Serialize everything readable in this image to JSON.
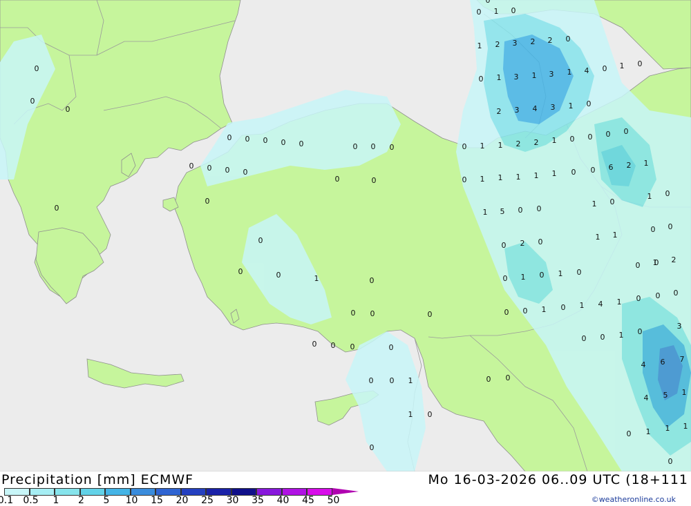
{
  "map": {
    "colors": {
      "sea": "#ececec",
      "land": "#c6f59c",
      "border": "#9a9a9a"
    },
    "precip_values": [
      [
        "0",
        "1",
        "0"
      ],
      [
        "1",
        "2",
        "3",
        "2",
        "2",
        "0"
      ],
      [
        "0",
        "1",
        "3",
        "1",
        "3",
        "1",
        "4",
        "0",
        "1",
        "0"
      ],
      [
        "2",
        "3",
        "4",
        "3",
        "1",
        "0"
      ],
      [
        "0",
        "1",
        "1",
        "2",
        "2",
        "1",
        "0",
        "0",
        "0",
        "0"
      ],
      [
        "0",
        "1",
        "1",
        "1",
        "1",
        "1",
        "0",
        "0",
        "6",
        "2",
        "1"
      ],
      [
        "1",
        "5",
        "0",
        "0",
        "1",
        "0",
        "1",
        "0"
      ],
      [
        "0",
        "2",
        "0",
        "1",
        "1",
        "0",
        "0",
        "1",
        "2"
      ],
      [
        "0",
        "1",
        "0",
        "1",
        "0",
        "0",
        "0",
        "0"
      ],
      [
        "0",
        "0",
        "1",
        "0",
        "1",
        "4",
        "1",
        "0",
        "0",
        "3"
      ],
      [
        "0",
        "0",
        "1",
        "0",
        "4",
        "6",
        "7"
      ],
      [
        "4",
        "5",
        "1",
        "0",
        "1",
        "1",
        "1",
        "0"
      ],
      [
        "0",
        "0",
        "0",
        "0",
        "0",
        "0",
        "0",
        "0",
        "0",
        "0",
        "0",
        "0",
        "0",
        "0",
        "0",
        "0",
        "0",
        "0",
        "0",
        "0",
        "0",
        "0",
        "0",
        "0",
        "0",
        "0",
        "0",
        "0",
        "0",
        "0",
        "0",
        "0",
        "0"
      ],
      [
        "1",
        "0",
        "1",
        "1",
        "0",
        "0",
        "0",
        "1",
        "0",
        "0",
        "1",
        "0",
        "0",
        "0",
        "0",
        "0",
        "0",
        "1",
        "1",
        "2",
        "1",
        "0",
        "1",
        "0",
        "0"
      ]
    ]
  },
  "legend": {
    "title": "Precipitation [mm] ECMWF",
    "datetime": "Mo 16-03-2026 06..09 UTC (18+111",
    "credit": "©weatheronline.co.uk",
    "ticks": [
      "0.1",
      "0.5",
      "1",
      "2",
      "5",
      "10",
      "15",
      "20",
      "25",
      "30",
      "35",
      "40",
      "45",
      "50"
    ],
    "colors": [
      "#c8f6f8",
      "#a6eef4",
      "#86e4ec",
      "#62d2e8",
      "#44b4e6",
      "#3a8cdc",
      "#2f64d2",
      "#2440c0",
      "#1a22a8",
      "#10108a",
      "#8818dc",
      "#b012e4",
      "#d80cea",
      "#c010b0"
    ]
  }
}
